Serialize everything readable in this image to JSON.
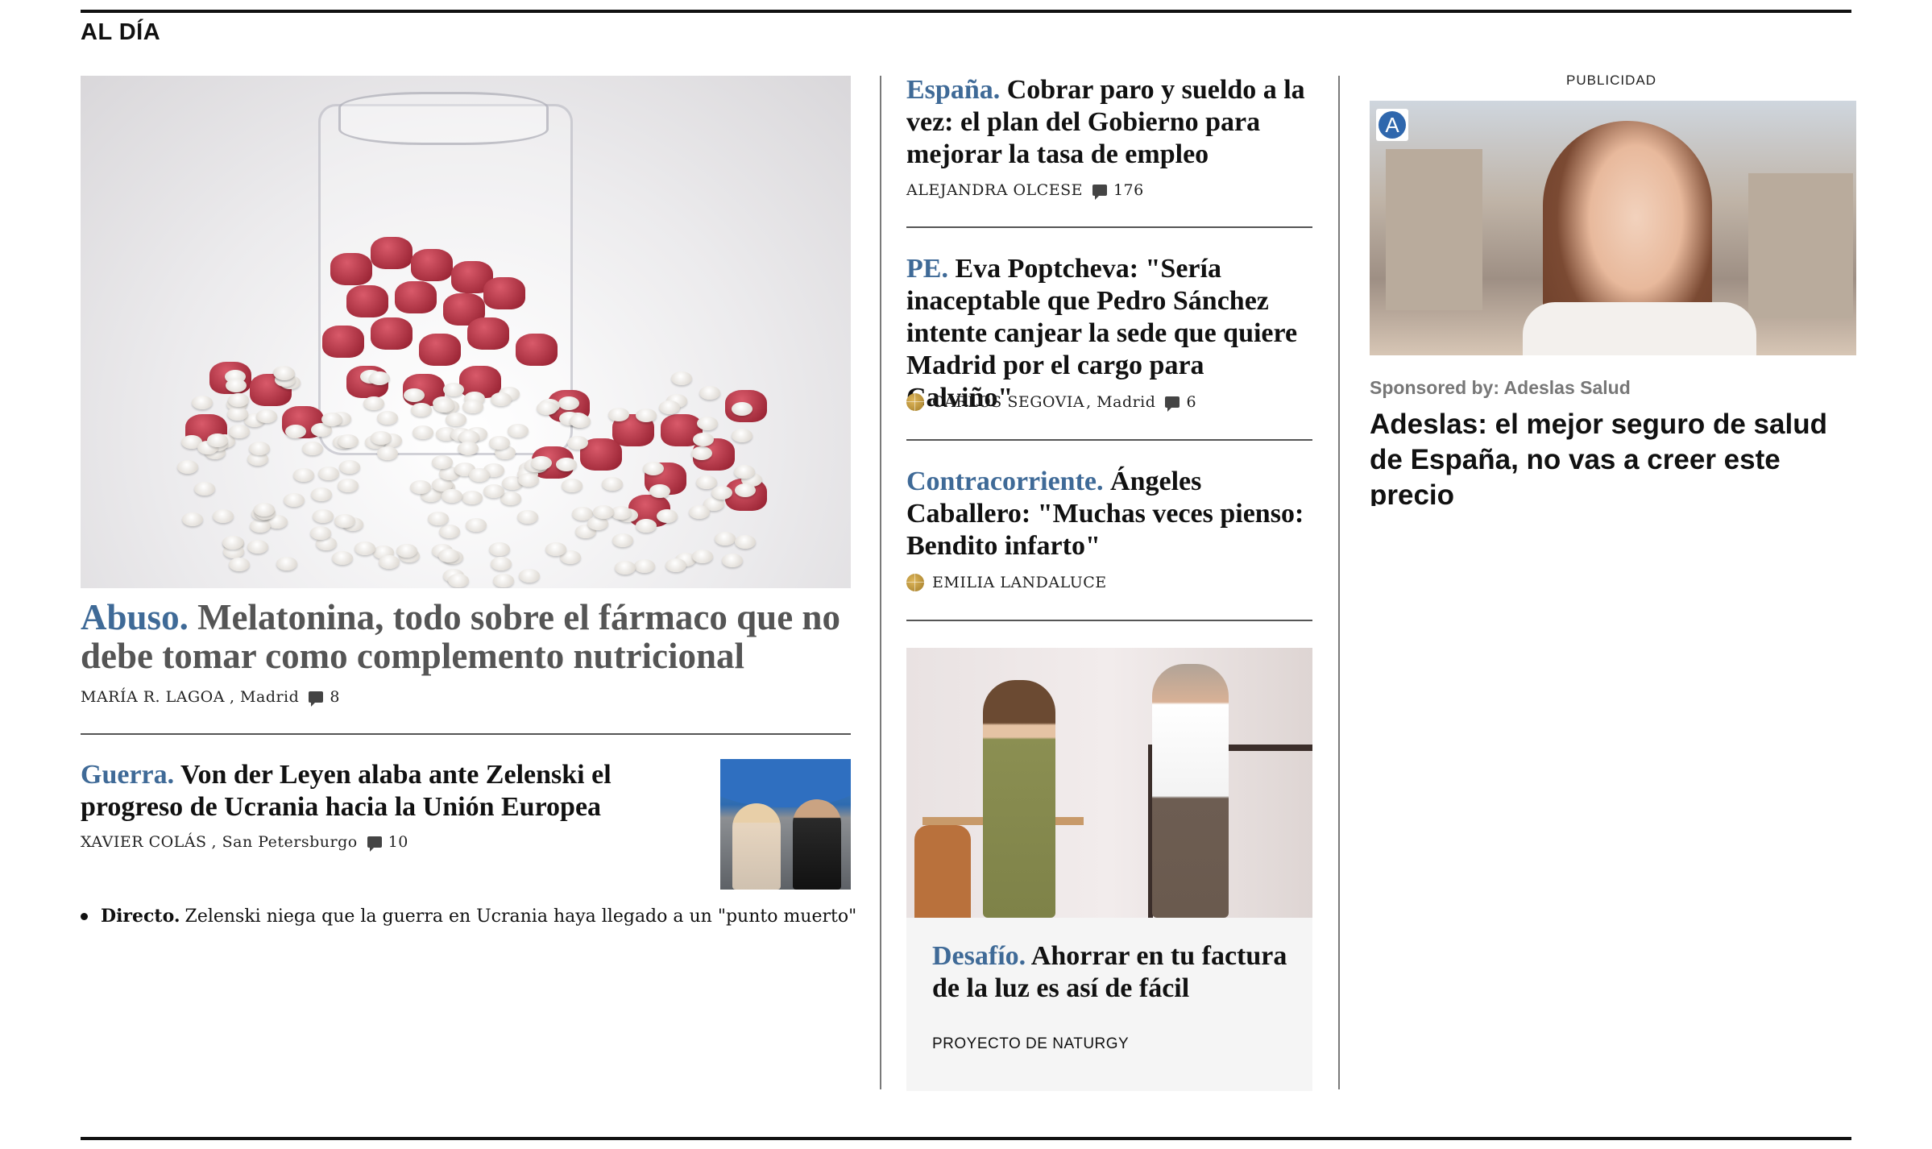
{
  "section": {
    "title": "AL DÍA"
  },
  "main": {
    "kicker": "Abuso.",
    "headline": "Melatonina, todo sobre el fármaco que no debe tomar como complemento nutricional",
    "author": "MARÍA R. LAGOA",
    "location": ", Madrid",
    "comments": "8"
  },
  "secondary": {
    "kicker": "Guerra.",
    "headline": "Von der Leyen alaba ante Zelenski el progreso de Ucrania hacia la Unión Europea",
    "author": "XAVIER COLÁS",
    "location": ", San Petersburgo",
    "comments": "10",
    "related_kicker": "Directo.",
    "related_text": "Zelenski niega que la guerra en Ucrania haya llegado a un \"punto muerto\""
  },
  "middle": {
    "items": [
      {
        "kicker": "España.",
        "headline": "Cobrar paro y sueldo a la vez: el plan del Gobierno para mejorar la tasa de empleo",
        "author": "ALEJANDRA OLCESE",
        "comments": "176"
      },
      {
        "kicker": "PE.",
        "headline": "Eva Poptcheva: \"Sería inaceptable que Pedro Sánchez intente canjear la sede que quiere Madrid por el cargo para Calviño\"",
        "author": "CARLOS SEGOVIA",
        "location": ", Madrid",
        "comments": "6"
      },
      {
        "kicker": "Contracorriente.",
        "headline": "Ángeles Caballero: \"Muchas veces pienso: Bendito infarto\"",
        "author": "EMILIA LANDALUCE"
      }
    ],
    "sponsored": {
      "kicker": "Desafío.",
      "headline": "Ahorrar en tu factura de la luz es así de fácil",
      "label": "PROYECTO DE NATURGY"
    }
  },
  "ad": {
    "label": "PUBLICIDAD",
    "badge": "A",
    "sponsor": "Sponsored by: Adeslas Salud",
    "title": "Adeslas: el mejor seguro de salud de España, no vas a creer este precio"
  }
}
